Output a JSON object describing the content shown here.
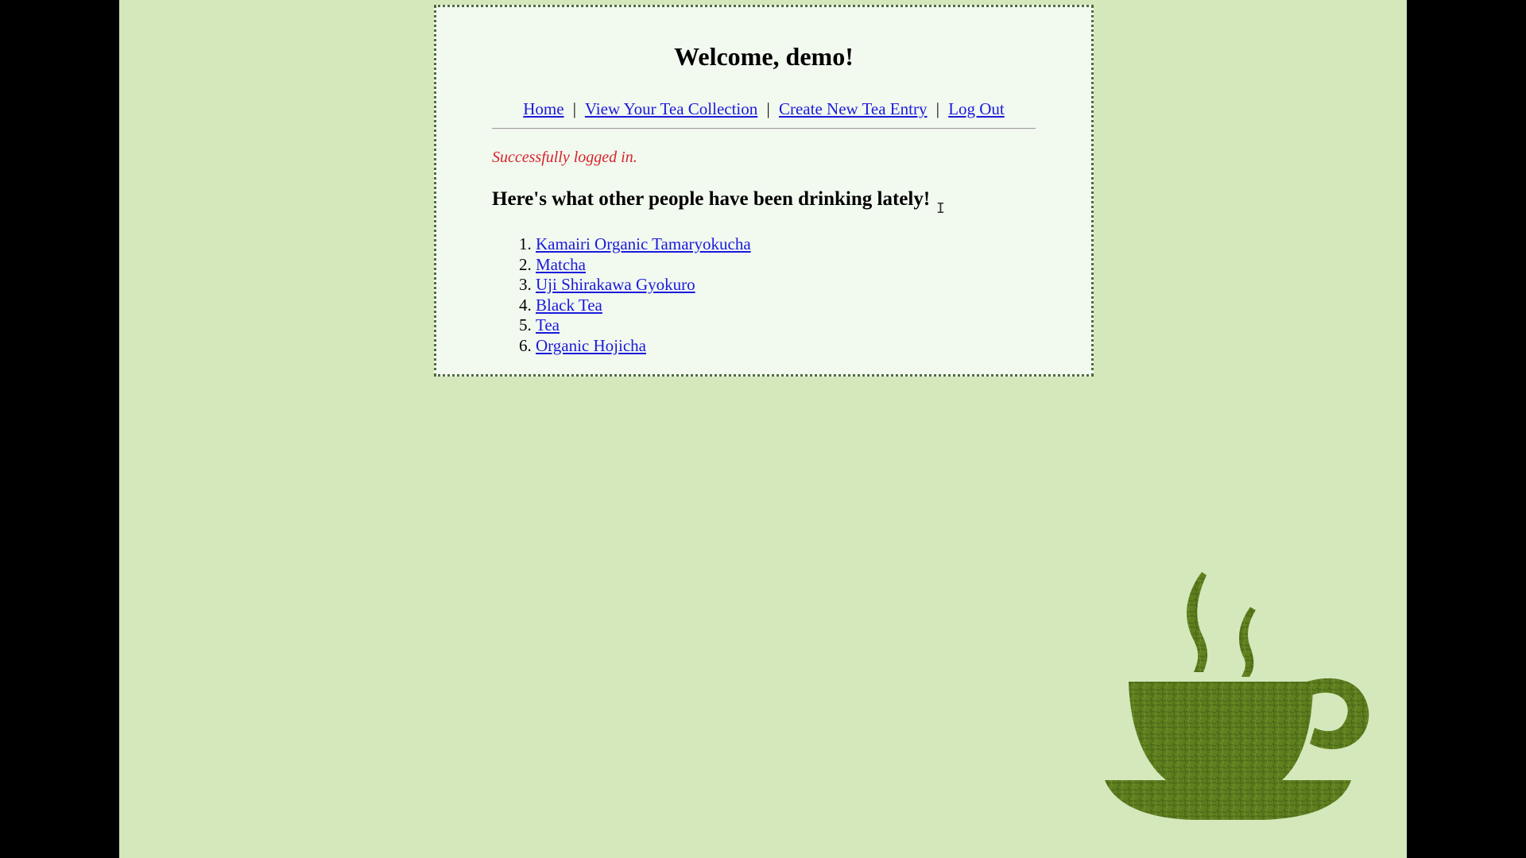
{
  "page": {
    "heading": "Welcome, demo!",
    "flash_message": "Successfully logged in.",
    "subheading": "Here's what other people have been drinking lately!"
  },
  "nav": {
    "home": "Home",
    "sep1": "|",
    "collection": "View Your Tea Collection",
    "sep2": "|",
    "create": "Create New Tea Entry",
    "sep3": "|",
    "logout": "Log Out"
  },
  "recent_teas": [
    "Kamairi Organic Tamaryokucha",
    "Matcha",
    "Uji Shirakawa Gyokuro",
    "Black Tea",
    "Tea",
    "Organic Hojicha"
  ],
  "colors": {
    "background": "#d4e8bc",
    "card": "#f2f9ef",
    "link": "#1a1adb",
    "flash": "#d8232a",
    "cup": "#5f7f1f"
  },
  "icons": {
    "decoration": "teacup-icon",
    "cursor": "text-cursor-icon"
  }
}
